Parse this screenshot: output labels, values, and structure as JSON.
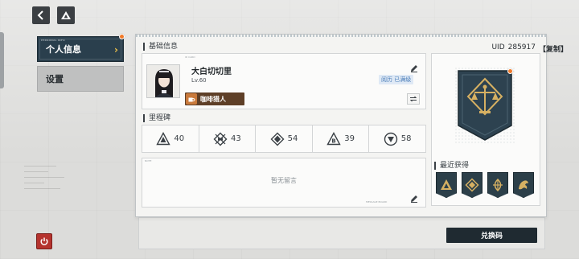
{
  "nav": {
    "back_icon": "chevron-left-icon",
    "home_icon": "triangle-logo-icon"
  },
  "sidebar": {
    "items": [
      {
        "label": "个人信息",
        "tiny": "PERSONAL INFO",
        "active": true,
        "has_alert": true
      },
      {
        "label": "设置",
        "active": false
      }
    ]
  },
  "profile": {
    "section_title": "基础信息",
    "uid_label": "UID",
    "uid_value": "285917",
    "copy_label": "【复制】",
    "name": "大白切切里",
    "level": "Lv.60",
    "experience_badge": "阅历 已满级",
    "title_tag": "咖啡猎人",
    "avatar_alt": "avatar"
  },
  "milestones": {
    "section_title": "里程碑",
    "items": [
      {
        "value": "40",
        "icon": "triangle-emblem-icon"
      },
      {
        "value": "43",
        "icon": "crossed-diamond-icon"
      },
      {
        "value": "54",
        "icon": "arrow-emblem-icon"
      },
      {
        "value": "39",
        "icon": "badge-b-icon"
      },
      {
        "value": "58",
        "icon": "circle-triangle-icon"
      }
    ]
  },
  "message": {
    "empty_text": "暂无留言"
  },
  "badge_panel": {
    "main_icon": "scales-emblem-icon",
    "recent_title": "最近获得",
    "recent_items": [
      "triangle-crest-icon",
      "diamond-crest-icon",
      "leaf-crest-icon",
      "dragon-crest-icon"
    ]
  },
  "actions": {
    "redeem_label": "兑换码"
  },
  "colors": {
    "accent_dark": "#2a3f4d",
    "alert": "#f07a2a",
    "badge_gold": "#d6b062",
    "power": "#b5332e"
  }
}
